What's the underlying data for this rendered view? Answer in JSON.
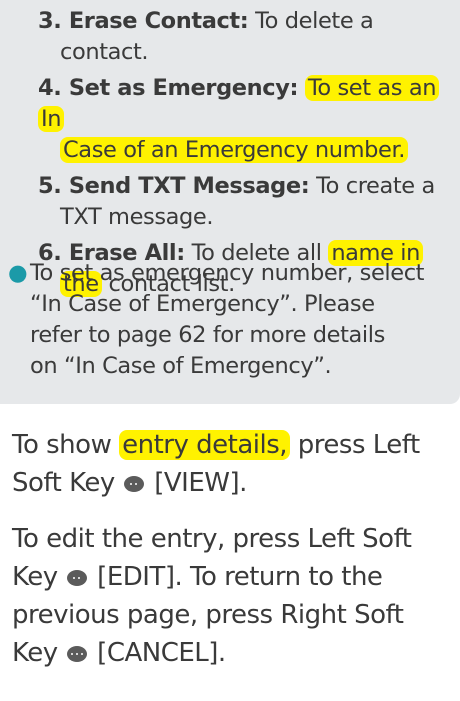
{
  "options": [
    {
      "number_term": "3. Erase Contact:",
      "desc_first": "To delete a",
      "desc_second": "contact."
    },
    {
      "number_term": "4. Set as Emergency:",
      "desc_highlight_1": "To set as an In",
      "desc_highlight_2": "Case of an Emergency number."
    },
    {
      "number_term": "5. Send TXT Message:",
      "desc_first": "To create a",
      "desc_second": "TXT message."
    },
    {
      "number_term": "6. Erase All:",
      "desc_plain": "To delete all",
      "desc_highlight_1": "name in",
      "desc_highlight_2": "the",
      "desc_tail": "contact list."
    }
  ],
  "bullet": {
    "line1": "To set as emergency number, select",
    "line2": "“In Case of Emergency”. Please",
    "line3": "refer to page 62 for more details",
    "line4": "on “In Case of Emergency”."
  },
  "para1": {
    "text_a": "To show",
    "highlight": "entry details,",
    "text_b": "press Left",
    "text_c": "Soft Key",
    "text_d": "[VIEW]."
  },
  "para2": {
    "line1": "To edit the entry, press Left Soft",
    "text_a": "Key",
    "text_b": "[EDIT]. To return to the",
    "line3": "previous page, press Right Soft",
    "text_c": "Key",
    "text_d": "[CANCEL]."
  },
  "icons": {
    "left_soft_key": "left-soft-key-icon",
    "right_soft_key": "right-soft-key-icon",
    "bullet": "bullet-dot-icon"
  },
  "colors": {
    "highlight": "#fff200",
    "note_background": "#e6e8ea",
    "bullet": "#1b9aa8",
    "text": "#3a3a3a"
  }
}
